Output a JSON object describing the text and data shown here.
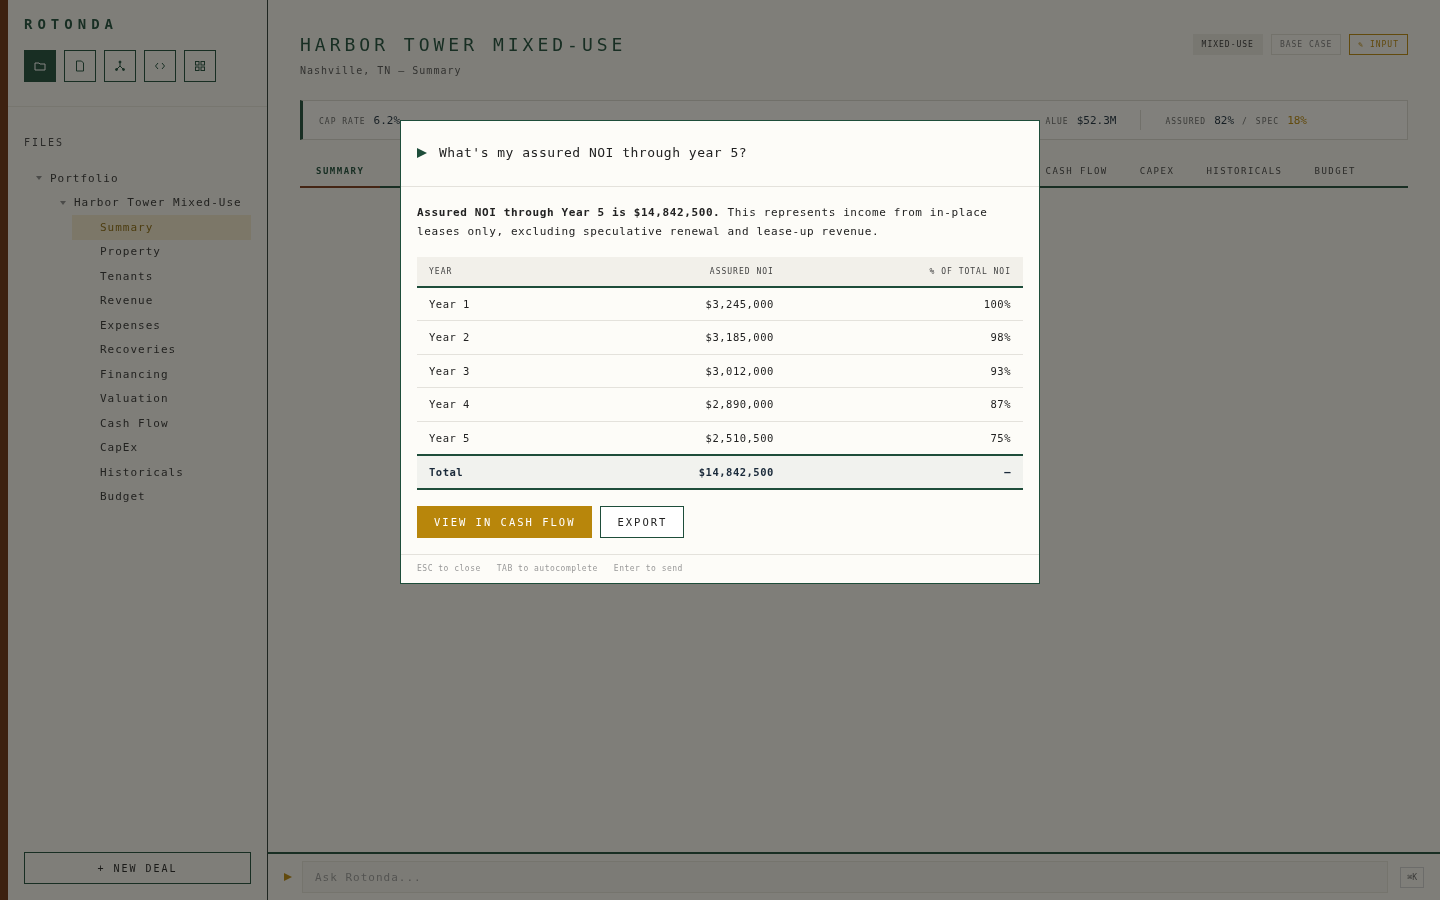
{
  "brand": "ROTONDA",
  "toolbar": [
    {
      "selected": true
    },
    {
      "selected": false
    },
    {
      "selected": false
    },
    {
      "selected": false
    },
    {
      "selected": false
    }
  ],
  "files_heading": "FILES",
  "tree": [
    {
      "label": "Portfolio",
      "expanded": true,
      "selected": false,
      "children": [
        {
          "label": "Harbor Tower Mixed-Use",
          "expanded": true,
          "selected": false,
          "children": [
            {
              "label": "Summary",
              "selected": true
            },
            {
              "label": "Property",
              "selected": false
            },
            {
              "label": "Tenants",
              "selected": false
            },
            {
              "label": "Revenue",
              "selected": false
            },
            {
              "label": "Expenses",
              "selected": false
            },
            {
              "label": "Recoveries",
              "selected": false
            },
            {
              "label": "Financing",
              "selected": false
            },
            {
              "label": "Valuation",
              "selected": false
            },
            {
              "label": "Cash Flow",
              "selected": false
            },
            {
              "label": "CapEx",
              "selected": false
            },
            {
              "label": "Historicals",
              "selected": false
            },
            {
              "label": "Budget",
              "selected": false
            }
          ]
        }
      ]
    }
  ],
  "new_deal": "+ NEW DEAL",
  "header": {
    "title": "HARBOR TOWER MIXED-USE",
    "subtitle": "Nashville, TN — Summary"
  },
  "badges": [
    {
      "label": "MIXED-USE",
      "kind": "tag"
    },
    {
      "label": "BASE CASE",
      "kind": "muted"
    },
    {
      "label": "✎ INPUT",
      "kind": "accent"
    }
  ],
  "metrics_left": [
    {
      "label": "CAP RATE",
      "value": "6.2%"
    }
  ],
  "metrics_right": [
    {
      "label": "ALUE",
      "value": "$52.3M"
    }
  ],
  "split": {
    "label_a": "ASSURED",
    "value_a": "82%",
    "sep": "/",
    "label_b": "SPEC",
    "value_b": "18%"
  },
  "tabs_left": [
    {
      "label": "SUMMARY",
      "selected": true
    }
  ],
  "tabs_right": [
    {
      "label": "CASH FLOW",
      "selected": false
    },
    {
      "label": "CAPEX",
      "selected": false
    },
    {
      "label": "HISTORICALS",
      "selected": false
    },
    {
      "label": "BUDGET",
      "selected": false
    }
  ],
  "modal": {
    "question": "What's my assured NOI through year 5?",
    "answer": "**Assured NOI through Year 5 is $14,842,500.** This represents income from in-place leases only, excluding speculative renewal and lease-up revenue.",
    "columns": [
      "YEAR",
      "ASSURED NOI",
      "% OF TOTAL NOI"
    ],
    "rows": [
      [
        "Year 1",
        "$3,245,000",
        "100%"
      ],
      [
        "Year 2",
        "$3,185,000",
        "98%"
      ],
      [
        "Year 3",
        "$3,012,000",
        "93%"
      ],
      [
        "Year 4",
        "$2,890,000",
        "87%"
      ],
      [
        "Year 5",
        "$2,510,500",
        "75%"
      ]
    ],
    "total": [
      "Total",
      "$14,842,500",
      "—"
    ],
    "buttons": [
      {
        "label": "VIEW IN CASH FLOW",
        "kind": "primary"
      },
      {
        "label": "EXPORT",
        "kind": "secondary"
      }
    ],
    "hints": [
      "ESC to close",
      "TAB to autocomplete",
      "Enter to send"
    ]
  },
  "ask": {
    "placeholder": "Ask Rotonda...",
    "shortcut": "⌘K"
  }
}
